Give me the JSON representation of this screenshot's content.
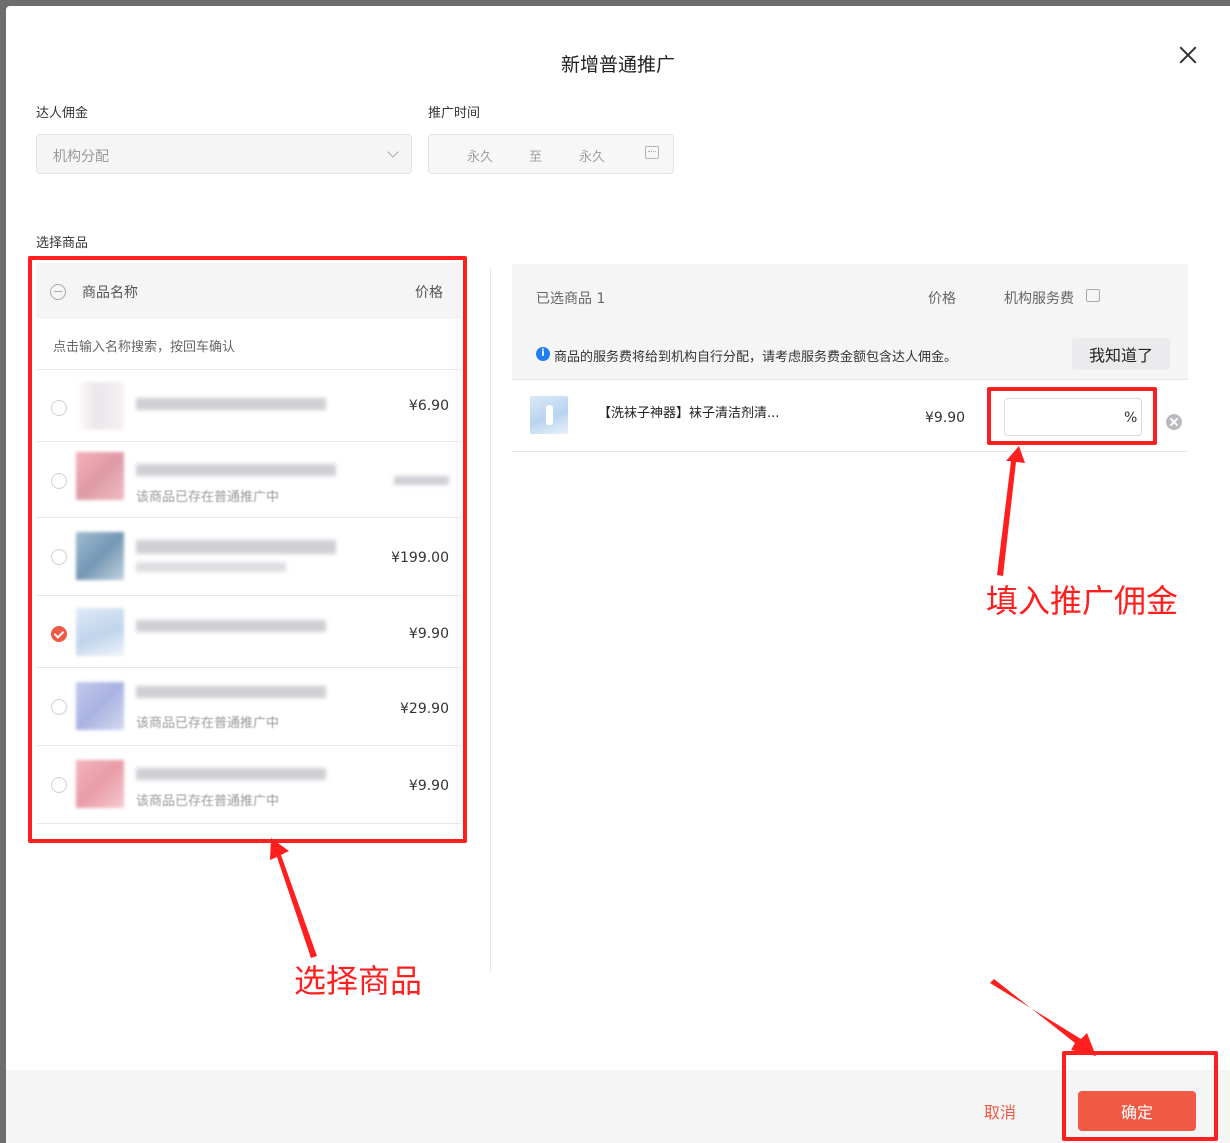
{
  "dialog": {
    "title": "新增普通推广"
  },
  "commission": {
    "label": "达人佣金",
    "value": "机构分配"
  },
  "time": {
    "label": "推广时间",
    "start": "永久",
    "sep": "至",
    "end": "永久"
  },
  "select_products_label": "选择商品",
  "product_list": {
    "col_name": "商品名称",
    "col_price": "价格",
    "search_placeholder": "点击输入名称搜索，按回车确认",
    "items": [
      {
        "price": "¥6.90",
        "note": "",
        "checked": false
      },
      {
        "price": "",
        "note": "该商品已存在普通推广中",
        "checked": false
      },
      {
        "price": "¥199.00",
        "note": "",
        "checked": false
      },
      {
        "price": "¥9.90",
        "note": "",
        "checked": true
      },
      {
        "price": "¥29.90",
        "note": "该商品已存在普通推广中",
        "checked": false
      },
      {
        "price": "¥9.90",
        "note": "该商品已存在普通推广中",
        "checked": false
      }
    ]
  },
  "selected": {
    "header": "已选商品 1",
    "col_price": "价格",
    "col_fee": "机构服务费",
    "notice": "商品的服务费将给到机构自行分配，请考虑服务费金额包含达人佣金。",
    "ack_button": "我知道了",
    "item": {
      "name": "【洗袜子神器】袜子清洁剂清...",
      "price": "¥9.90",
      "fee_value": "",
      "unit": "%"
    }
  },
  "footer": {
    "cancel": "取消",
    "confirm": "确定"
  },
  "annotations": {
    "fill_commission": "填入推广佣金",
    "select_products": "选择商品"
  },
  "colors": {
    "accent": "#f05a45",
    "annotation": "#ff1f1f",
    "info": "#1f7ef5"
  }
}
